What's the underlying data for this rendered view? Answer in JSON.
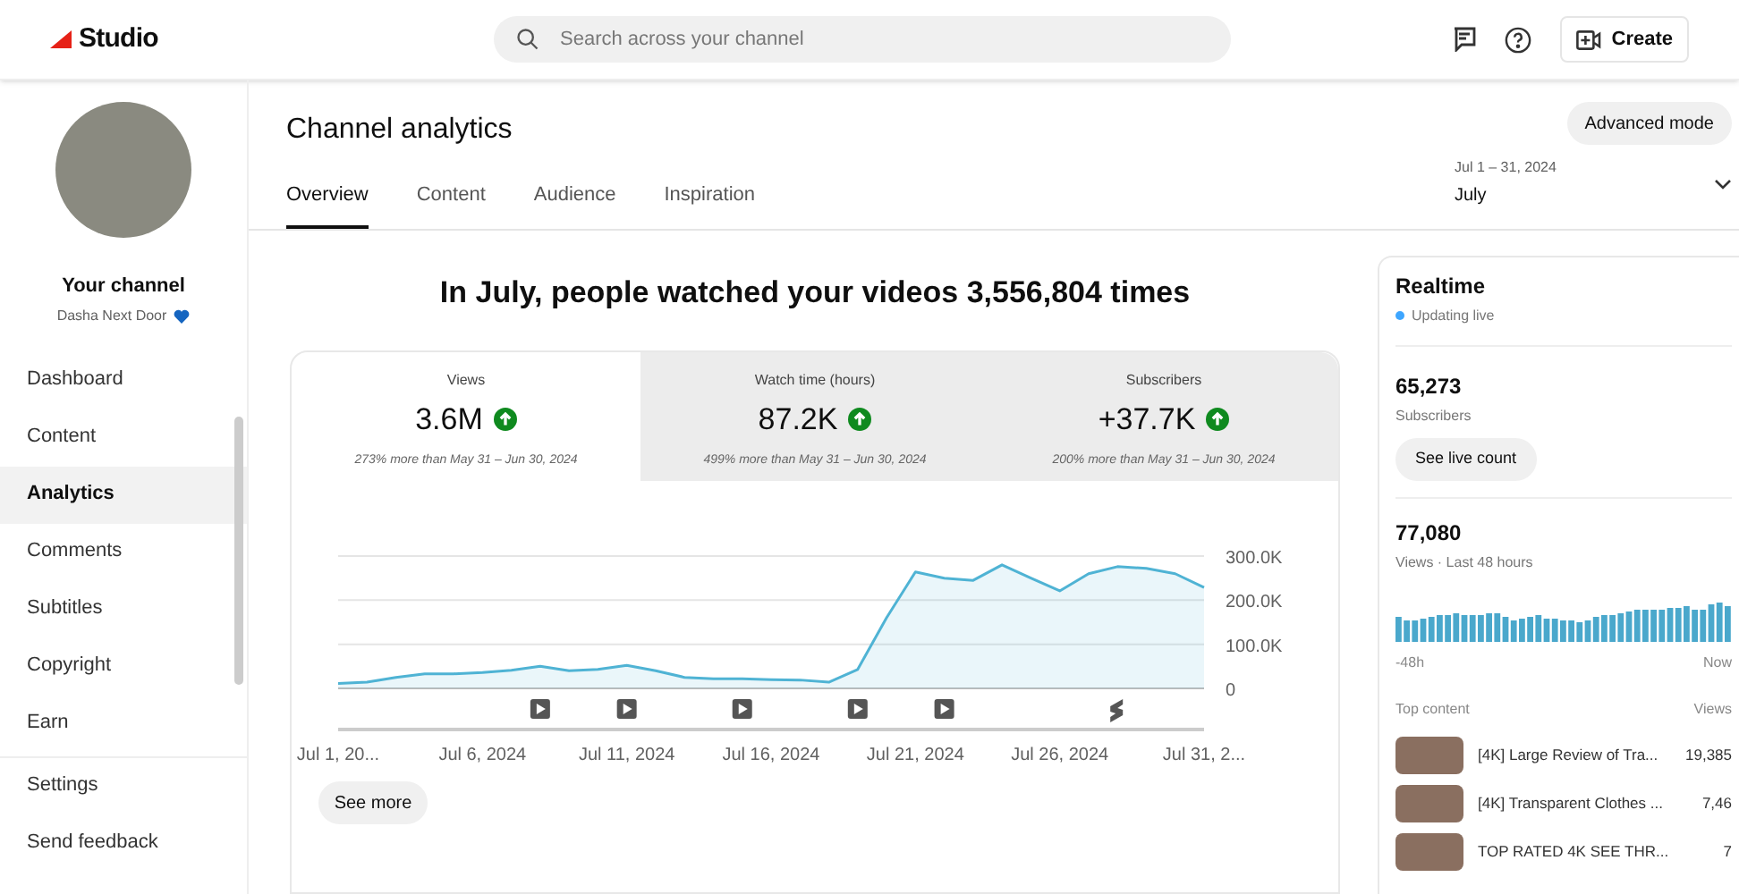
{
  "topbar": {
    "logo": "Studio",
    "search": {
      "placeholder": "Search across your channel"
    },
    "create": "Create"
  },
  "sidebar": {
    "channel_label": "Your channel",
    "channel_name": "Dasha Next Door",
    "items": [
      {
        "label": "Dashboard",
        "selected": false
      },
      {
        "label": "Content",
        "selected": false
      },
      {
        "label": "Analytics",
        "selected": true
      },
      {
        "label": "Comments",
        "selected": false
      },
      {
        "label": "Subtitles",
        "selected": false
      },
      {
        "label": "Copyright",
        "selected": false
      },
      {
        "label": "Earn",
        "selected": false
      }
    ],
    "footer_items": [
      "Settings",
      "Send feedback"
    ]
  },
  "header": {
    "title": "Channel analytics",
    "advanced": "Advanced mode",
    "tabs": [
      {
        "label": "Overview",
        "selected": true
      },
      {
        "label": "Content",
        "selected": false
      },
      {
        "label": "Audience",
        "selected": false
      },
      {
        "label": "Inspiration",
        "selected": false
      }
    ],
    "date_range": {
      "range": "Jul 1 – 31, 2024",
      "label": "July"
    }
  },
  "headline": "In July, people watched your videos 3,556,804 times",
  "metrics": [
    {
      "label": "Views",
      "value": "3.6M",
      "comparison": "273% more than May 31 – Jun 30, 2024",
      "selected": true
    },
    {
      "label": "Watch time (hours)",
      "value": "87.2K",
      "comparison": "499% more than May 31 – Jun 30, 2024",
      "selected": false
    },
    {
      "label": "Subscribers",
      "value": "+37.7K",
      "comparison": "200% more than May 31 – Jun 30, 2024",
      "selected": false
    }
  ],
  "chart_data": {
    "type": "area",
    "categories": [
      "Jul 1, 20...",
      null,
      null,
      null,
      null,
      "Jul 6, 2024",
      null,
      null,
      null,
      null,
      "Jul 11, 2024",
      null,
      null,
      null,
      null,
      "Jul 16, 2024",
      null,
      null,
      null,
      null,
      "Jul 21, 2024",
      null,
      null,
      null,
      null,
      "Jul 26, 2024",
      null,
      null,
      null,
      null,
      "Jul 31, 2..."
    ],
    "series": [
      {
        "color": "#4fb3d4",
        "values": [
          11000,
          14000,
          25000,
          33000,
          33000,
          36000,
          41000,
          50000,
          40000,
          43000,
          52000,
          40000,
          25000,
          22000,
          22000,
          20000,
          19000,
          14000,
          43000,
          160000,
          264000,
          250000,
          245000,
          280000,
          250000,
          221000,
          260000,
          276000,
          272000,
          260000,
          229000
        ]
      }
    ],
    "ylim": [
      0,
      300000
    ],
    "yticks": [
      {
        "value": 0,
        "label": "0"
      },
      {
        "value": 100000,
        "label": "100.0K"
      },
      {
        "value": 200000,
        "label": "200.0K"
      },
      {
        "value": 300000,
        "label": "300.0K"
      }
    ]
  },
  "see_more": "See more",
  "realtime": {
    "title": "Realtime",
    "status": "Updating live",
    "subscribers": "65,273",
    "subscribers_label": "Subscribers",
    "live_button": "See live count",
    "views": "77,080",
    "views_label": "Views · Last 48 hours",
    "axis_start": "-48h",
    "axis_end": "Now",
    "top_content_label": "Top content",
    "views_column": "Views",
    "top_content": [
      {
        "title": "[4K] Large Review of Tra...",
        "views": "19,385"
      },
      {
        "title": "[4K] Transparent Clothes ...",
        "views": "7,46"
      },
      {
        "title": "TOP RATED 4K SEE THR...",
        "views": "7"
      }
    ]
  }
}
